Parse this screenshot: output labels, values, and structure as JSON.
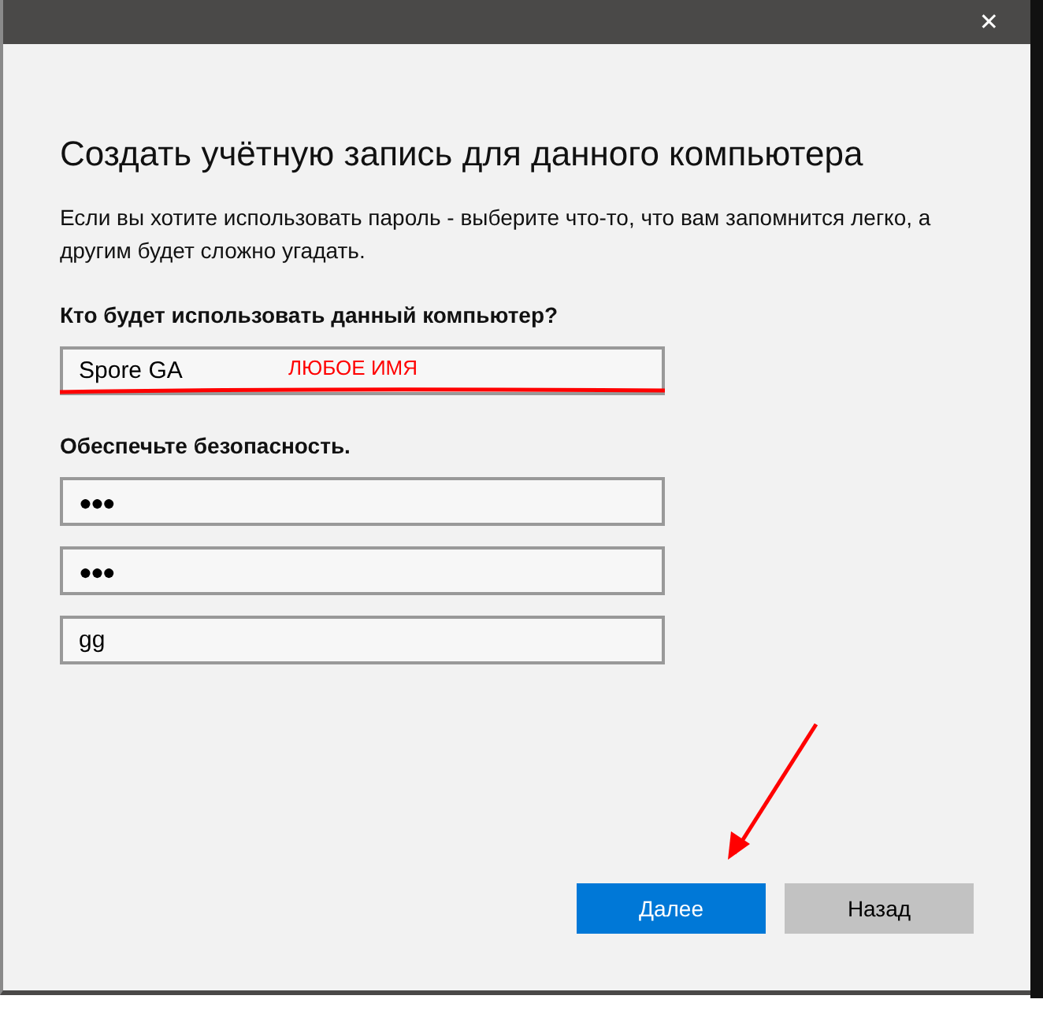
{
  "window": {
    "title_bar": {
      "close": "✕"
    }
  },
  "heading": "Создать учётную запись для данного компьютера",
  "description": "Если вы хотите использовать пароль - выберите что-то, что вам запомнится легко, а другим будет сложно угадать.",
  "sections": [
    {
      "label": "Кто будет использовать данный компьютер?",
      "fields": [
        {
          "kind": "text",
          "value": "Spore GA",
          "annotation": "ЛЮБОЕ ИМЯ"
        }
      ]
    },
    {
      "label": "Обеспечьте безопасность.",
      "fields": [
        {
          "kind": "password",
          "value": "●●●"
        },
        {
          "kind": "password",
          "value": "●●●"
        },
        {
          "kind": "text",
          "value": "gg"
        }
      ]
    }
  ],
  "buttons": [
    {
      "label": "Далее",
      "primary": true
    },
    {
      "label": "Назад",
      "primary": false
    }
  ]
}
